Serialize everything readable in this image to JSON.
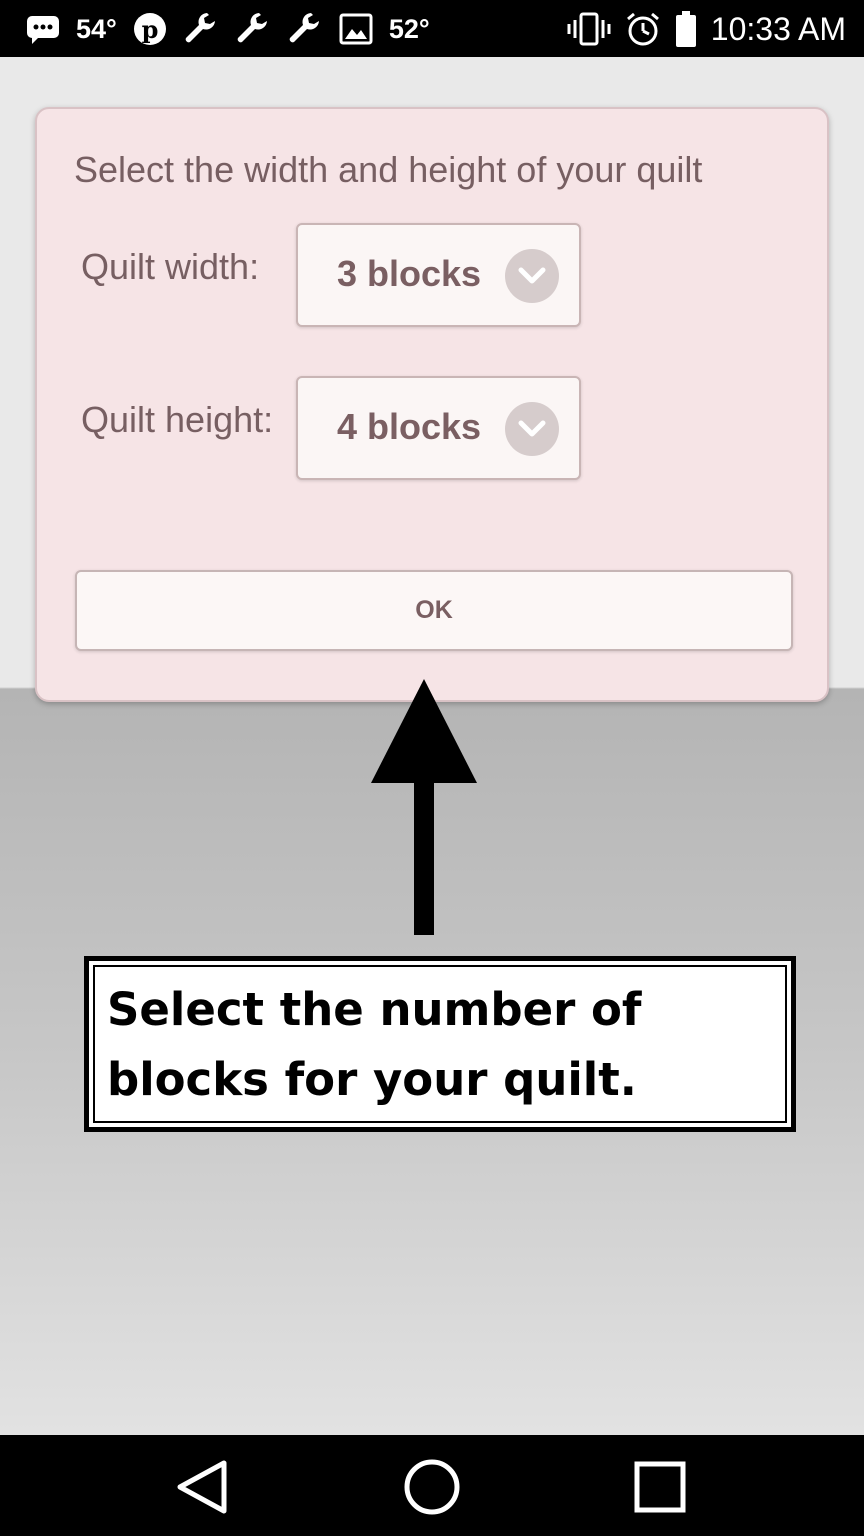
{
  "status_bar": {
    "weather_temp": "54°",
    "weather_temp_2": "52°",
    "time": "10:33 AM",
    "icons_left": [
      "message-icon",
      "pinterest-icon",
      "wrench-icon",
      "wrench-icon",
      "wrench-icon",
      "image-icon"
    ],
    "icons_right": [
      "vibrate-icon",
      "alarm-icon",
      "battery-icon"
    ]
  },
  "dialog": {
    "title": "Select the width and height of your quilt",
    "width_label": "Quilt width:",
    "width_value": "3 blocks",
    "height_label": "Quilt height:",
    "height_value": "4 blocks",
    "ok_label": "OK"
  },
  "callout": {
    "text": "Select the number of blocks for your quilt."
  },
  "nav_bar": {
    "buttons": [
      "back-icon",
      "home-icon",
      "recents-icon"
    ]
  },
  "colors": {
    "dialog_bg": "#f6e4e6",
    "text": "#775f62",
    "status_bg": "#000000"
  }
}
